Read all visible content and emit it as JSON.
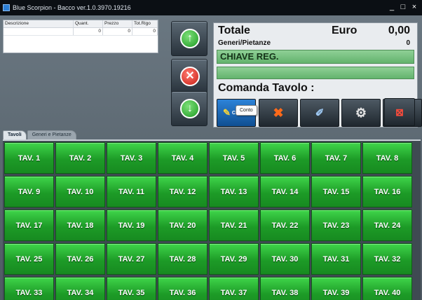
{
  "window": {
    "title": "Blue Scorpion - Bacco ver.1.0.3970.19216",
    "minimize": "_",
    "maximize": "□",
    "close": "×"
  },
  "order_table": {
    "columns": [
      "Descrizione",
      "Quant.",
      "Prezzo",
      "Tot.Rigo"
    ],
    "rows": [
      [
        "",
        "0",
        "0",
        "0"
      ]
    ]
  },
  "side_buttons": {
    "up": "↑",
    "cancel": "✕",
    "down": "↓"
  },
  "totals": {
    "label": "Totale",
    "currency": "Euro",
    "amount": "0,00",
    "generi_label": "Generi/Pietanze",
    "generi_count": "0",
    "chiave": "CHIAVE REG.",
    "empty_bar": "",
    "comanda": "Comanda Tavolo :"
  },
  "func_buttons": {
    "conto": "CONTO",
    "tooltip": "Conto"
  },
  "tabs": [
    "Tavoli",
    "Generi e Pietanze"
  ],
  "tables": [
    "TAV. 1",
    "TAV. 2",
    "TAV. 3",
    "TAV. 4",
    "TAV. 5",
    "TAV. 6",
    "TAV. 7",
    "TAV. 8",
    "TAV. 9",
    "TAV. 10",
    "TAV. 11",
    "TAV. 12",
    "TAV. 13",
    "TAV. 14",
    "TAV. 15",
    "TAV. 16",
    "TAV. 17",
    "TAV. 18",
    "TAV. 19",
    "TAV. 20",
    "TAV. 21",
    "TAV. 22",
    "TAV. 23",
    "TAV. 24",
    "TAV. 25",
    "TAV. 26",
    "TAV. 27",
    "TAV. 28",
    "TAV. 29",
    "TAV. 30",
    "TAV. 31",
    "TAV. 32",
    "TAV. 33",
    "TAV. 34",
    "TAV. 35",
    "TAV. 36",
    "TAV. 37",
    "TAV. 38",
    "TAV. 39",
    "TAV. 40"
  ],
  "colors": {
    "table_green": "#22a82c",
    "bar_green": "#7cc585",
    "cancel_red": "#c81e14"
  }
}
